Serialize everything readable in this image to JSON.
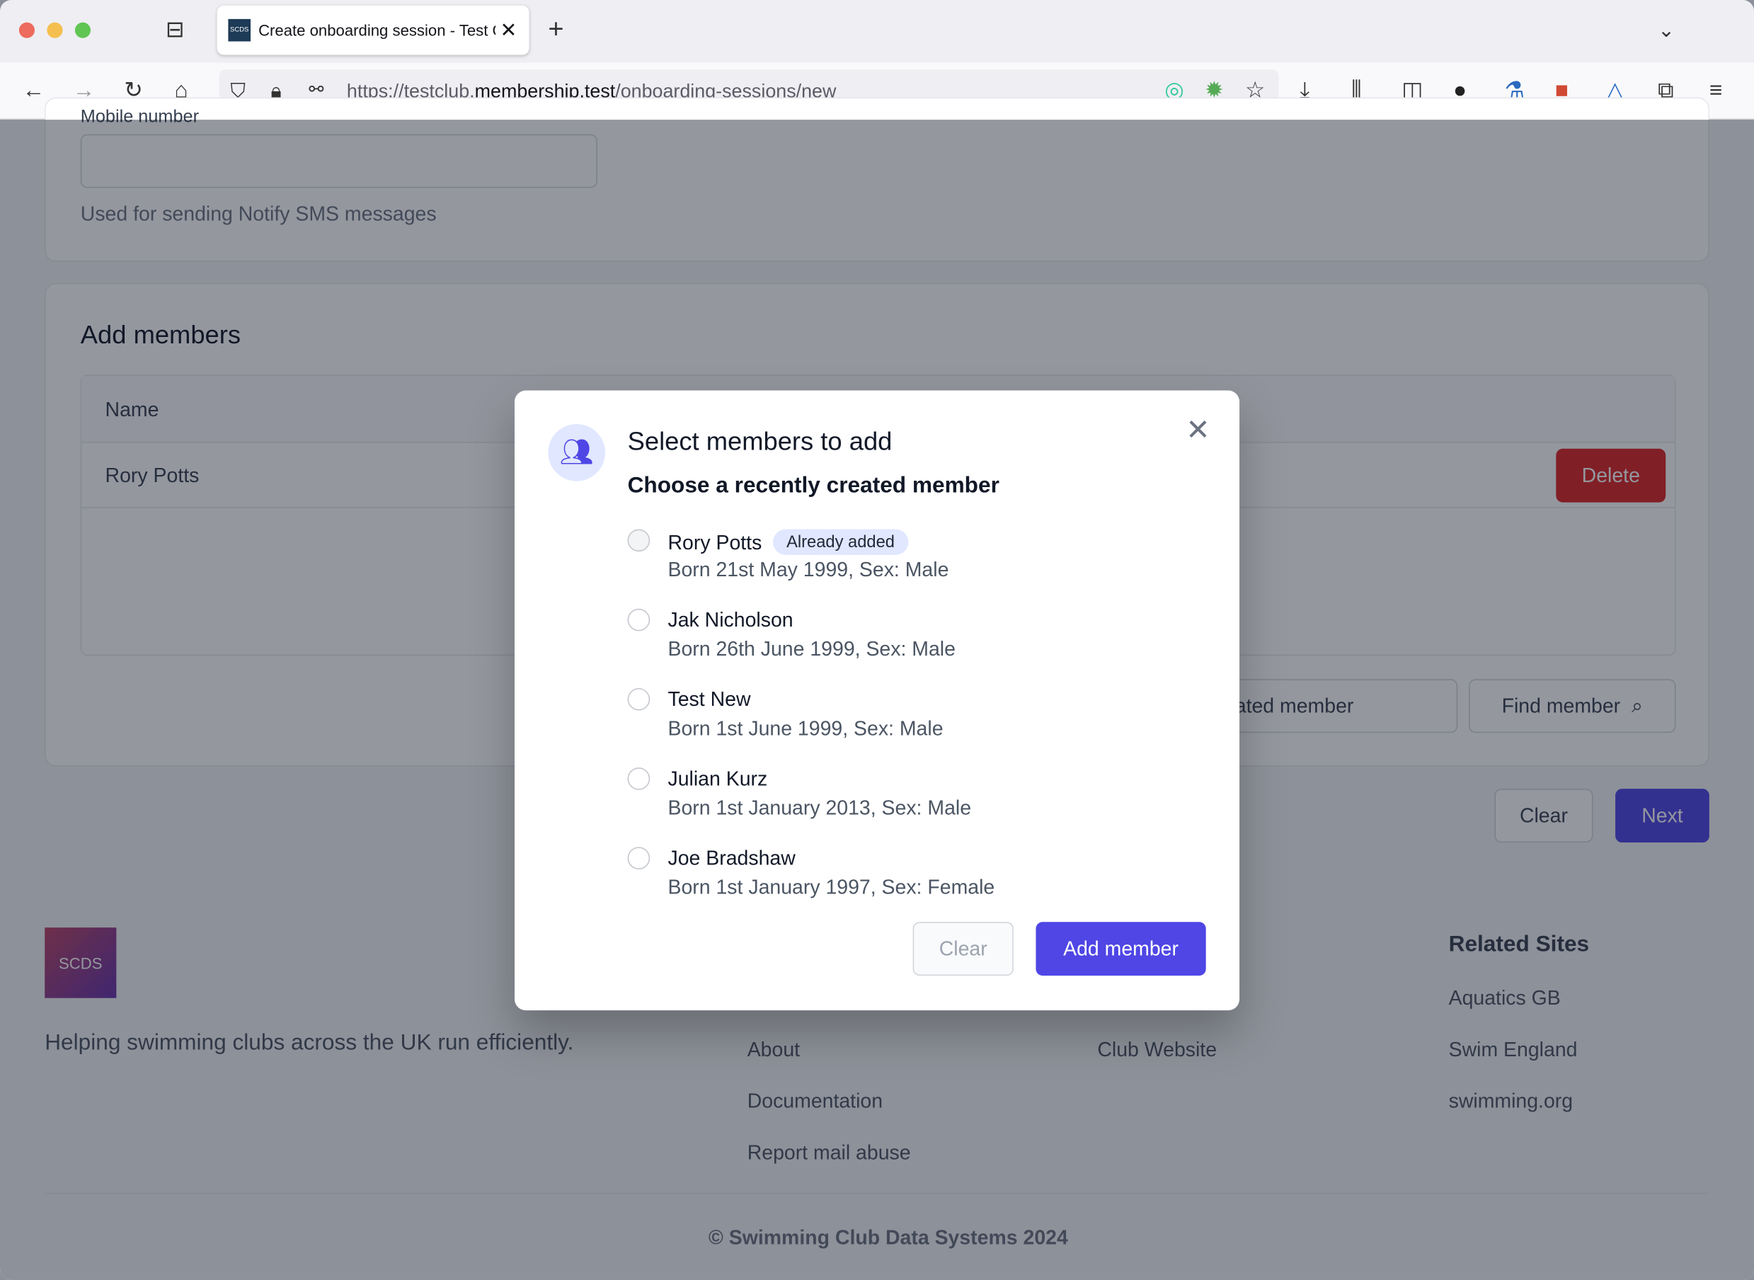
{
  "browser": {
    "tab_title": "Create onboarding session - Test Club",
    "tab_favicon_text": "SCDS",
    "url_prefix": "https://testclub.",
    "url_domain": "membership.test",
    "url_path": "/onboarding-sessions/new"
  },
  "page": {
    "mobile_label": "Mobile number",
    "mobile_help": "Used for sending Notify SMS messages",
    "add_members_title": "Add members",
    "table_header_name": "Name",
    "rows": [
      {
        "name": "Rory Potts",
        "delete_label": "Delete"
      }
    ],
    "add_recent_label": "Add recently created member",
    "find_member_label": "Find member",
    "clear_label": "Clear",
    "next_label": "Next"
  },
  "footer": {
    "logo_text": "SCDS",
    "tagline": "Helping swimming clubs across the UK run efficiently.",
    "links_col1": [
      "About",
      "Documentation",
      "Report mail abuse"
    ],
    "links_col2": [
      "Club Website"
    ],
    "related_title": "Related Sites",
    "related_links": [
      "Aquatics GB",
      "Swim England",
      "swimming.org"
    ],
    "copyright": "© Swimming Club Data Systems 2024"
  },
  "modal": {
    "title": "Select members to add",
    "subtitle": "Choose a recently created member",
    "members": [
      {
        "name": "Rory Potts",
        "badge": "Already added",
        "details": "Born 21st May 1999, Sex: Male"
      },
      {
        "name": "Jak Nicholson",
        "details": "Born 26th June 1999, Sex: Male"
      },
      {
        "name": "Test New",
        "details": "Born 1st June 1999, Sex: Male"
      },
      {
        "name": "Julian Kurz",
        "details": "Born 1st January 2013, Sex: Male"
      },
      {
        "name": "Joe Bradshaw",
        "details": "Born 1st January 1997, Sex: Female"
      }
    ],
    "clear_label": "Clear",
    "add_label": "Add member",
    "accent": "#4f46e5"
  }
}
